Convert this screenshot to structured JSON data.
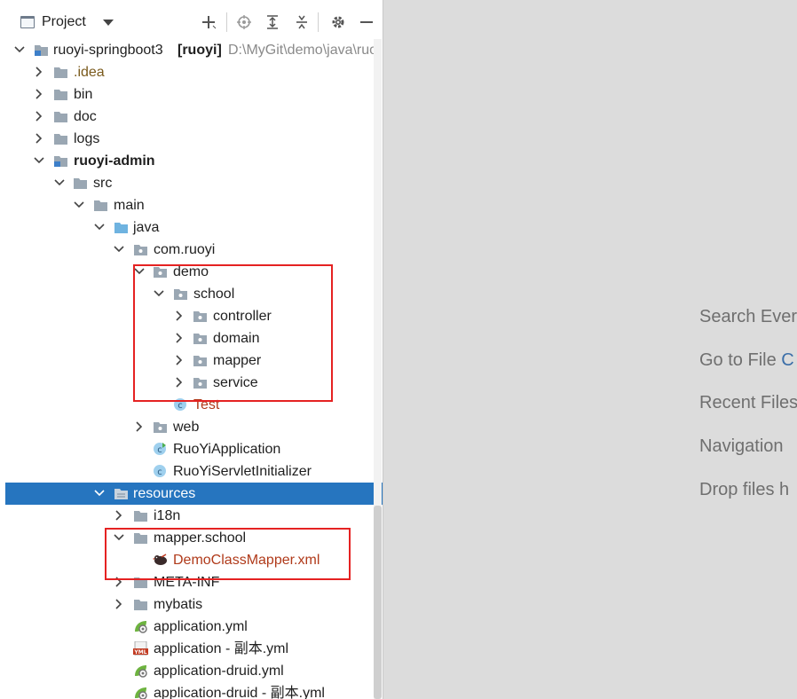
{
  "toolbar": {
    "title": "Project",
    "icons": [
      "add-icon",
      "locate-icon",
      "expand-all-icon",
      "collapse-all-icon",
      "gear-icon",
      "minimize-icon"
    ]
  },
  "tree": {
    "root": {
      "name": "ruoyi-springboot3",
      "tag": "[ruoyi]",
      "path": "D:\\MyGit\\demo\\java\\ruo"
    },
    "idea": ".idea",
    "bin": "bin",
    "doc": "doc",
    "logs": "logs",
    "ruoyi_admin": "ruoyi-admin",
    "src": "src",
    "main": "main",
    "java": "java",
    "com_ruoyi": "com.ruoyi",
    "demo": "demo",
    "school": "school",
    "controller": "controller",
    "domain": "domain",
    "mapper": "mapper",
    "service": "service",
    "test": "Test",
    "web": "web",
    "app": "RuoYiApplication",
    "servlet": "RuoYiServletInitializer",
    "resources": "resources",
    "i18n": "i18n",
    "mapper_school": "mapper.school",
    "democlass": "DemoClassMapper.xml",
    "meta_inf": "META-INF",
    "mybatis": "mybatis",
    "app_yml": "application.yml",
    "app_copy_yml": "application - 副本.yml",
    "app_druid_yml": "application-druid.yml",
    "app_druid_copy_yml": "application-druid - 副本.yml"
  },
  "hints": {
    "search": "Search Ever",
    "goto_prefix": "Go to File ",
    "goto_accent": "C",
    "recent": "Recent Files",
    "navigation": "Navigation",
    "drop": "Drop files h"
  },
  "colors": {
    "selection": "#2675bf",
    "highlight_box": "#e52222",
    "editor_bg": "#dcdcdc"
  }
}
